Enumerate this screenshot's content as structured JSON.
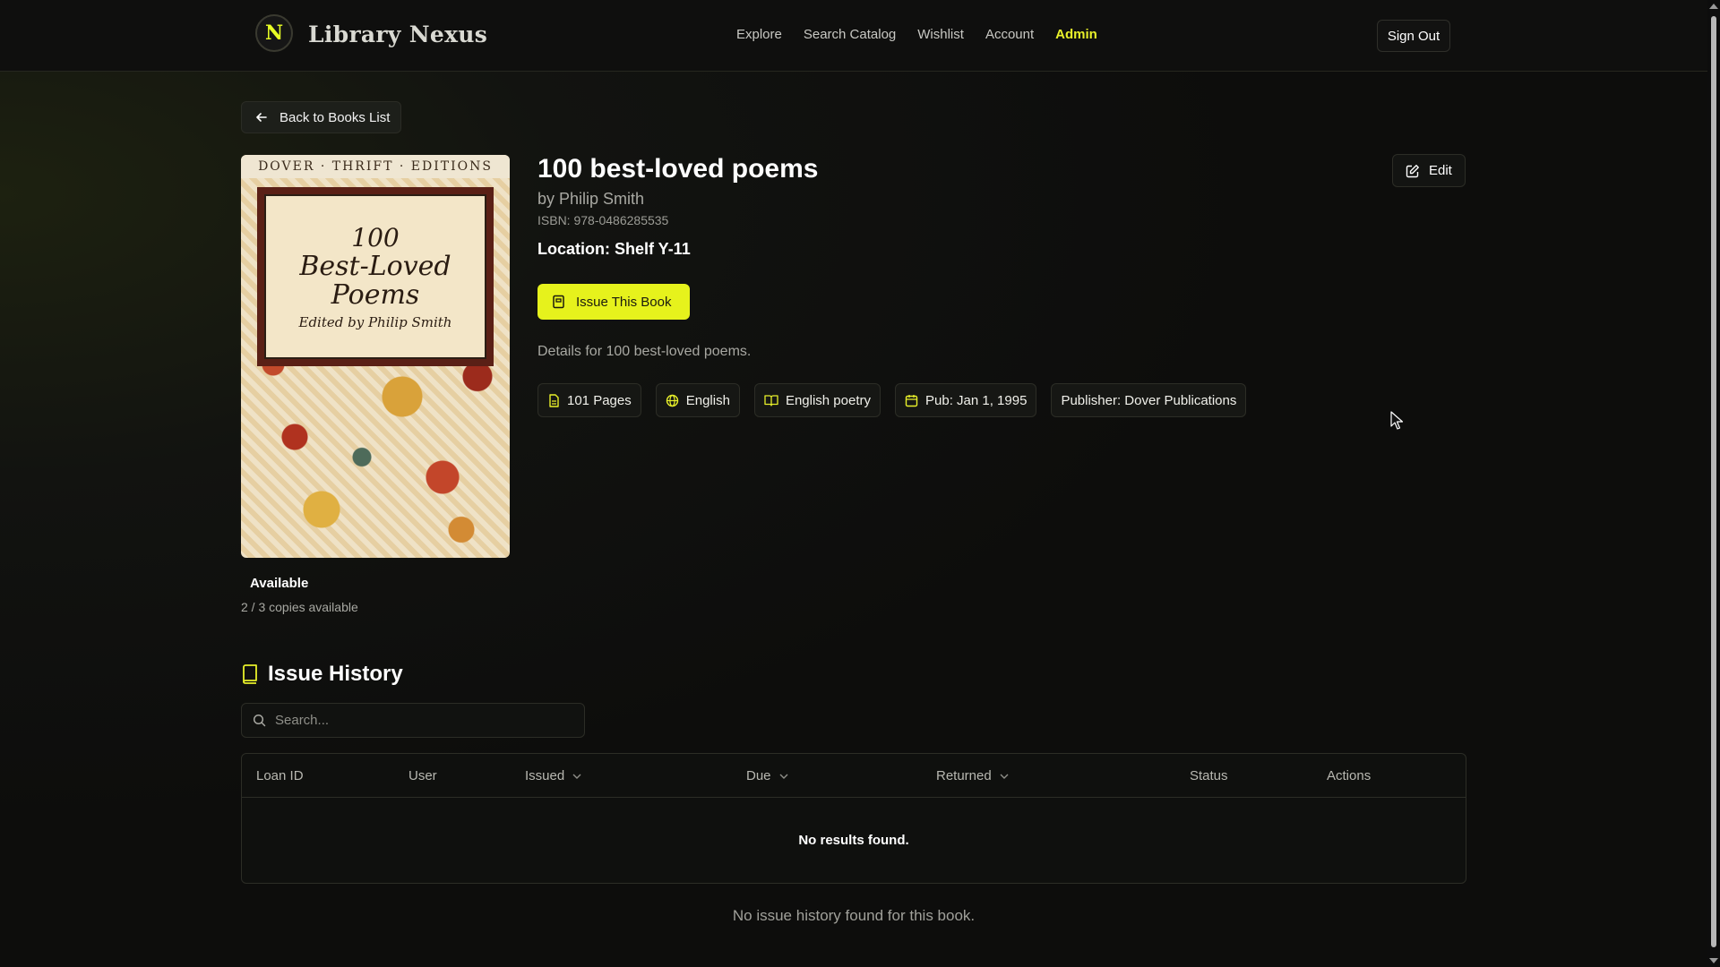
{
  "header": {
    "logo_letter": "N",
    "brand": "Library Nexus",
    "nav": [
      {
        "label": "Explore"
      },
      {
        "label": "Search Catalog"
      },
      {
        "label": "Wishlist"
      },
      {
        "label": "Account"
      },
      {
        "label": "Admin",
        "active": true
      }
    ],
    "sign_out": "Sign Out"
  },
  "back_button": "Back to Books List",
  "book": {
    "cover": {
      "series": "DOVER · THRIFT · EDITIONS",
      "number": "100",
      "title_line1": "Best-Loved",
      "title_line2": "Poems",
      "editor": "Edited by Philip Smith"
    },
    "title": "100 best-loved poems",
    "author": "by Philip Smith",
    "isbn": "ISBN: 978-0486285535",
    "location": "Location: Shelf Y-11",
    "issue_button": "Issue This Book",
    "details": "Details for 100 best-loved poems.",
    "tags": [
      {
        "icon": "file-icon",
        "label": "101 Pages"
      },
      {
        "icon": "globe-icon",
        "label": "English"
      },
      {
        "icon": "book-open-icon",
        "label": "English poetry"
      },
      {
        "icon": "calendar-icon",
        "label": "Pub: Jan 1, 1995"
      },
      {
        "icon": "",
        "label": "Publisher: Dover Publications"
      }
    ],
    "availability": "Available",
    "copies": "2 / 3 copies available",
    "edit_button": "Edit"
  },
  "history": {
    "heading": "Issue History",
    "search_placeholder": "Search...",
    "columns": [
      "Loan ID",
      "User",
      "Issued",
      "Due",
      "Returned",
      "Status",
      "Actions"
    ],
    "empty_table": "No results found.",
    "empty_message": "No issue history found for this book."
  },
  "colors": {
    "accent": "#e6f21c",
    "background": "#0e0e0d",
    "border": "#2c2d26"
  }
}
